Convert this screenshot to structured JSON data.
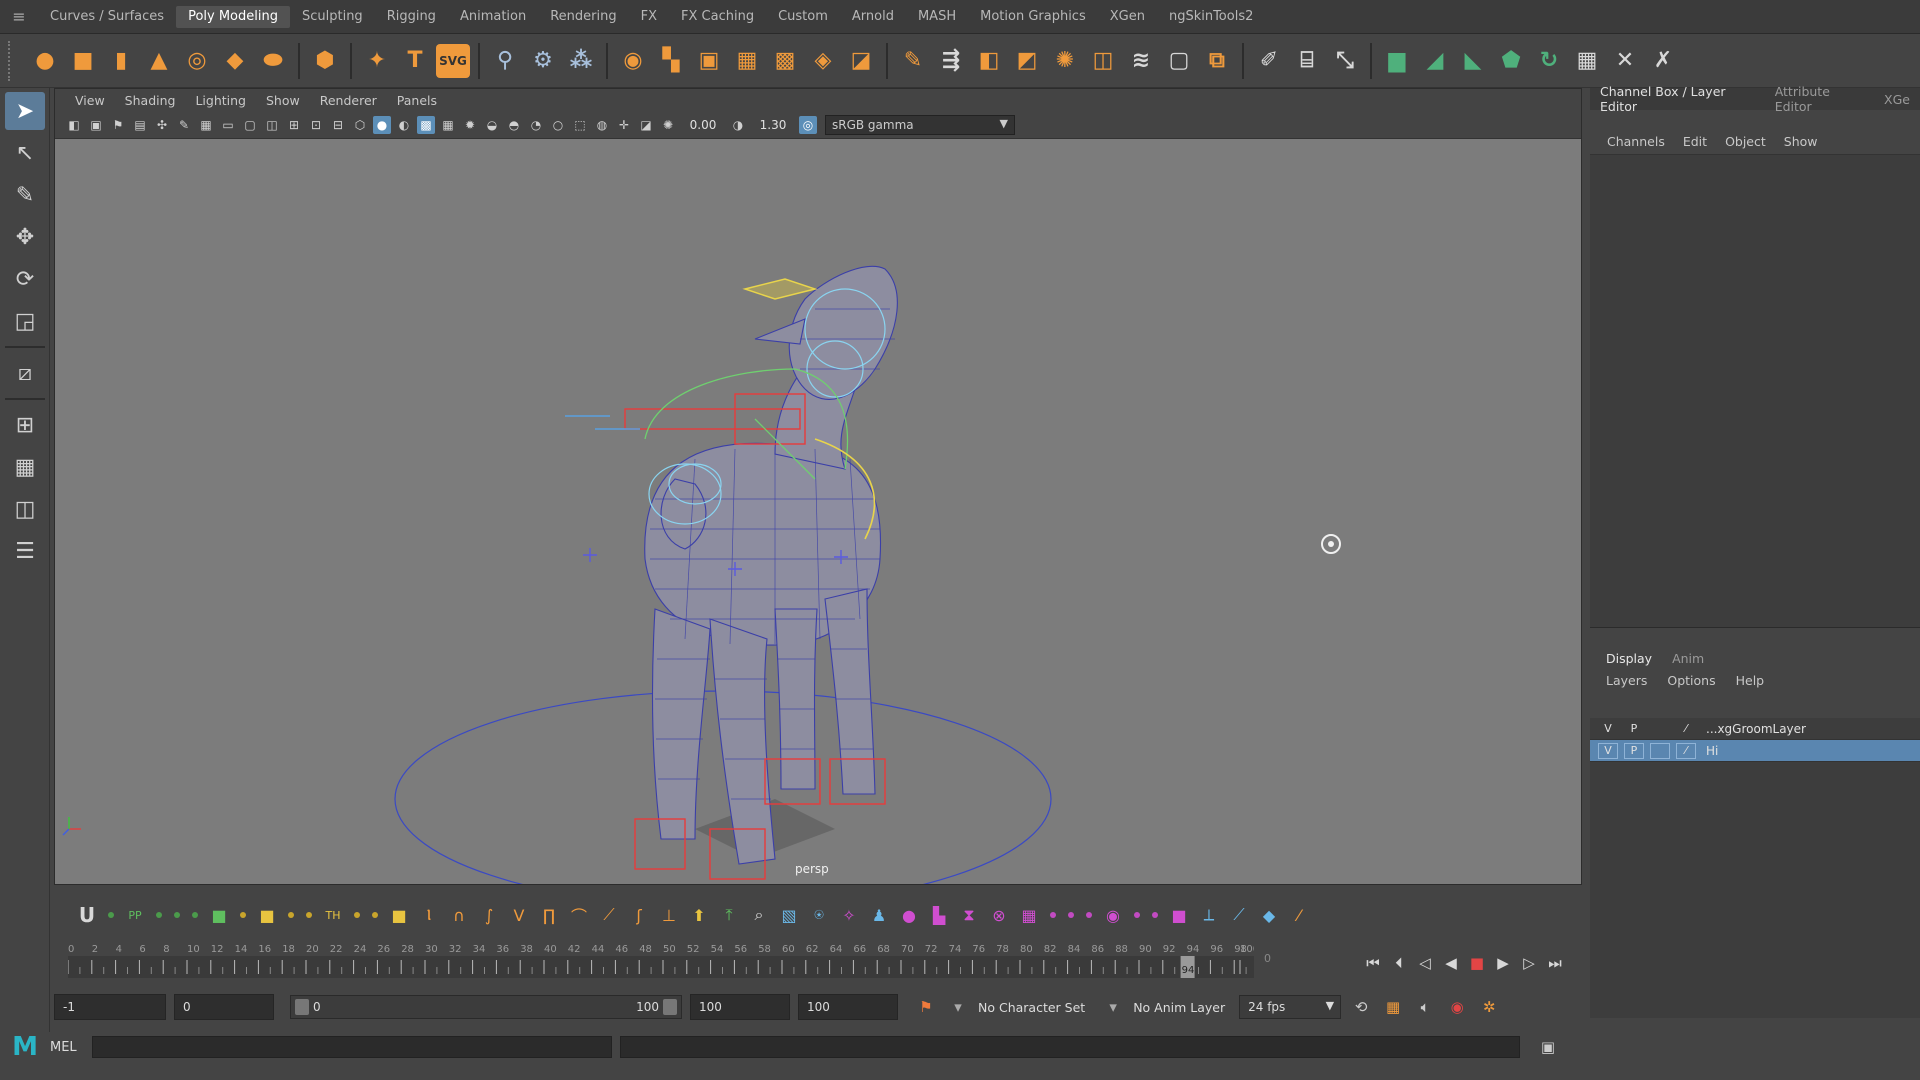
{
  "shelf": {
    "tabs": [
      "Curves / Surfaces",
      "Poly Modeling",
      "Sculpting",
      "Rigging",
      "Animation",
      "Rendering",
      "FX",
      "FX Caching",
      "Custom",
      "Arnold",
      "MASH",
      "Motion Graphics",
      "XGen",
      "ngSkinTools2"
    ],
    "active_tab": "Poly Modeling",
    "svg_icon_label": "SVG"
  },
  "viewport": {
    "menu": [
      "View",
      "Shading",
      "Lighting",
      "Show",
      "Renderer",
      "Panels"
    ],
    "exposure": "0.00",
    "gamma": "1.30",
    "color_space": "sRGB gamma",
    "camera": "persp"
  },
  "right_panel": {
    "tabs": [
      "Channel Box / Layer Editor",
      "Attribute Editor",
      "XGe"
    ],
    "channel_menu": [
      "Channels",
      "Edit",
      "Object",
      "Show"
    ],
    "display_tabs": [
      "Display",
      "Anim"
    ],
    "display_menu": [
      "Layers",
      "Options",
      "Help"
    ],
    "layers": [
      {
        "v": "V",
        "p": "P",
        "name": "...xgGroomLayer",
        "selected": false
      },
      {
        "v": "V",
        "p": "P",
        "name": "Hi",
        "selected": true
      }
    ]
  },
  "timeline": {
    "tick_labels": [
      "0",
      "2",
      "4",
      "6",
      "8",
      "10",
      "12",
      "14",
      "16",
      "18",
      "20",
      "22",
      "24",
      "26",
      "28",
      "30",
      "32",
      "34",
      "36",
      "38",
      "40",
      "42",
      "44",
      "46",
      "48",
      "50",
      "52",
      "54",
      "56",
      "58",
      "60",
      "62",
      "64",
      "66",
      "68",
      "70",
      "72",
      "74",
      "76",
      "78",
      "80",
      "82",
      "84",
      "86",
      "88",
      "90",
      "92",
      "94",
      "96",
      "98",
      "100"
    ],
    "current_frame": "94",
    "right_value": "0"
  },
  "range": {
    "current": "-1",
    "start": "0",
    "slider_start": "0",
    "slider_end": "100",
    "end": "100",
    "anim_end": "100",
    "character_set": "No Character Set",
    "anim_layer": "No Anim Layer",
    "fps": "24 fps"
  },
  "command_line": {
    "label": "MEL"
  },
  "colors": {
    "accent": "#5a86b0",
    "shelf_icon": "#ef9a3c",
    "viewport_bg": "#7c7c7c",
    "wireframe": "#3b3fa8"
  }
}
